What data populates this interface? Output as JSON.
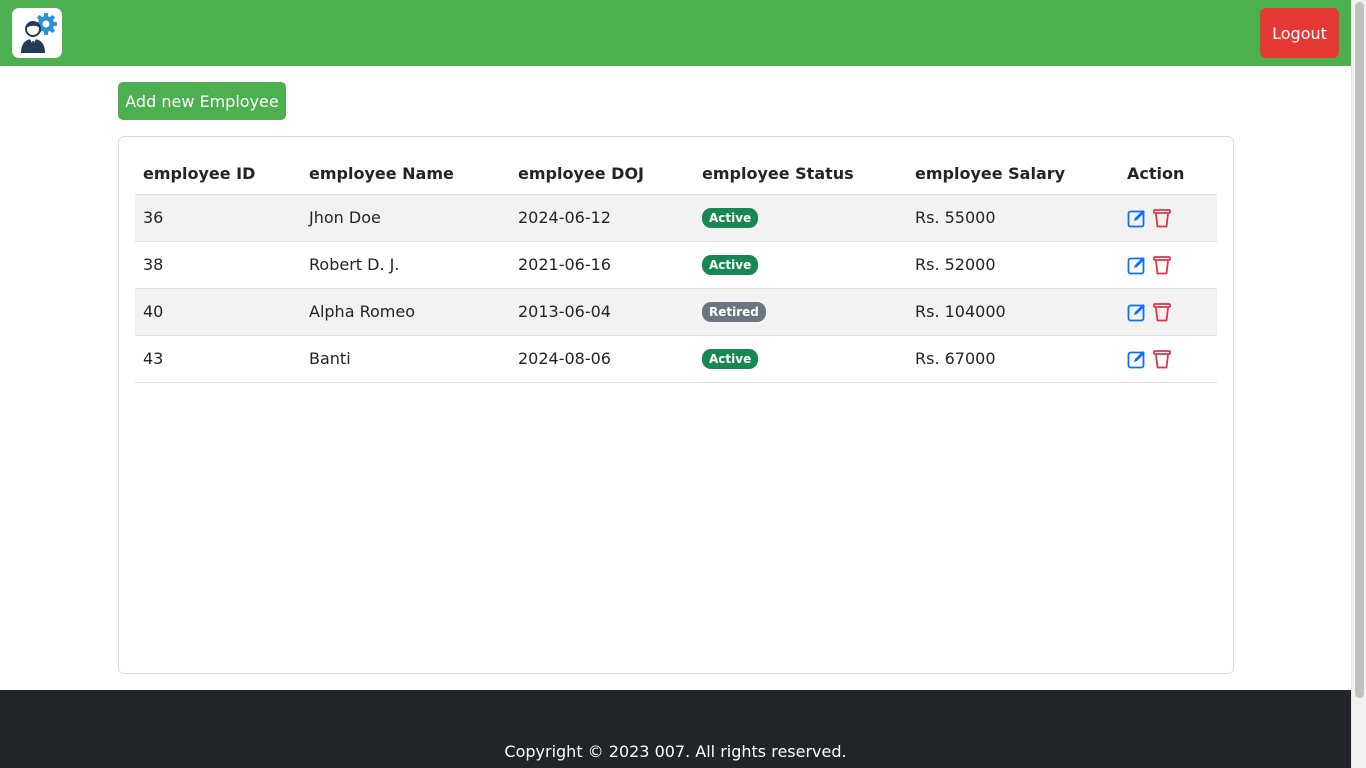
{
  "header": {
    "logo_icon": "employee-gear-icon",
    "logout_label": "Logout",
    "bg_color": "#4caf50",
    "logout_color": "#e53935"
  },
  "toolbar": {
    "add_label": "Add new Employee"
  },
  "table": {
    "columns": [
      "employee ID",
      "employee Name",
      "employee DOJ",
      "employee Status",
      "employee Salary",
      "Action"
    ],
    "rows": [
      {
        "id": "36",
        "name": "Jhon Doe",
        "doj": "2024-06-12",
        "status": "Active",
        "salary": "Rs. 55000"
      },
      {
        "id": "38",
        "name": "Robert D. J.",
        "doj": "2021-06-16",
        "status": "Active",
        "salary": "Rs. 52000"
      },
      {
        "id": "40",
        "name": "Alpha Romeo",
        "doj": "2013-06-04",
        "status": "Retired",
        "salary": "Rs. 104000"
      },
      {
        "id": "43",
        "name": "Banti",
        "doj": "2024-08-06",
        "status": "Active",
        "salary": "Rs. 67000"
      }
    ],
    "action_icons": [
      "edit-icon",
      "delete-icon"
    ],
    "status_colors": {
      "Active": "#198754",
      "Retired": "#6c757d"
    }
  },
  "footer": {
    "copyright": "Copyright © 2023 007. All rights reserved."
  }
}
